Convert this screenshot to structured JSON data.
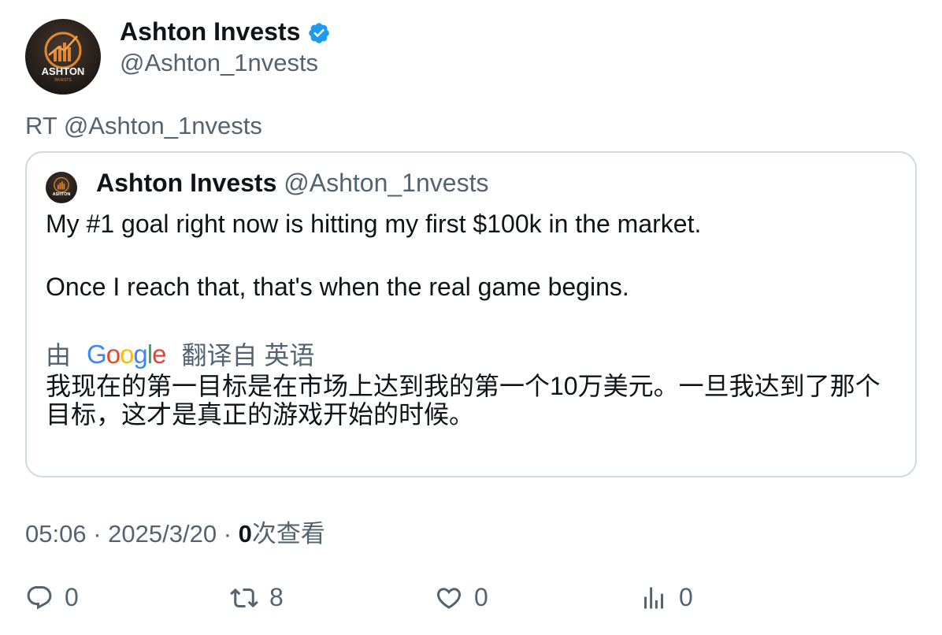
{
  "author": {
    "name": "Ashton Invests",
    "handle": "@Ashton_1nvests",
    "avatar_text": "ASHTON",
    "avatar_subtext": "INVESTS",
    "verified": true
  },
  "retweet_line": "RT @Ashton_1nvests",
  "quoted": {
    "name": "Ashton Invests",
    "handle": "@Ashton_1nvests",
    "lines": [
      "My #1 goal right now is hitting my first $100k in the market.",
      "Once I reach that, that's when the real game begins."
    ],
    "translation": {
      "prefix": "由",
      "logo": "Google",
      "suffix": "翻译自 英语",
      "text": "我现在的第一目标是在市场上达到我的第一个10万美元。一旦我达到了那个目标，这才是真正的游戏开始的时候。"
    }
  },
  "meta": {
    "time": "05:06",
    "separator": "·",
    "date": "2025/3/20",
    "views_count": "0",
    "views_label": "次查看"
  },
  "actions": {
    "reply_count": "0",
    "retweet_count": "8",
    "like_count": "0",
    "views_count": "0"
  },
  "colors": {
    "text_primary": "#0f1419",
    "text_secondary": "#536471",
    "border": "#cfd9de",
    "verified": "#1d9bf0"
  },
  "icons": [
    "verified-badge-icon",
    "reply-icon",
    "retweet-icon",
    "like-icon",
    "views-icon",
    "google-logo"
  ]
}
